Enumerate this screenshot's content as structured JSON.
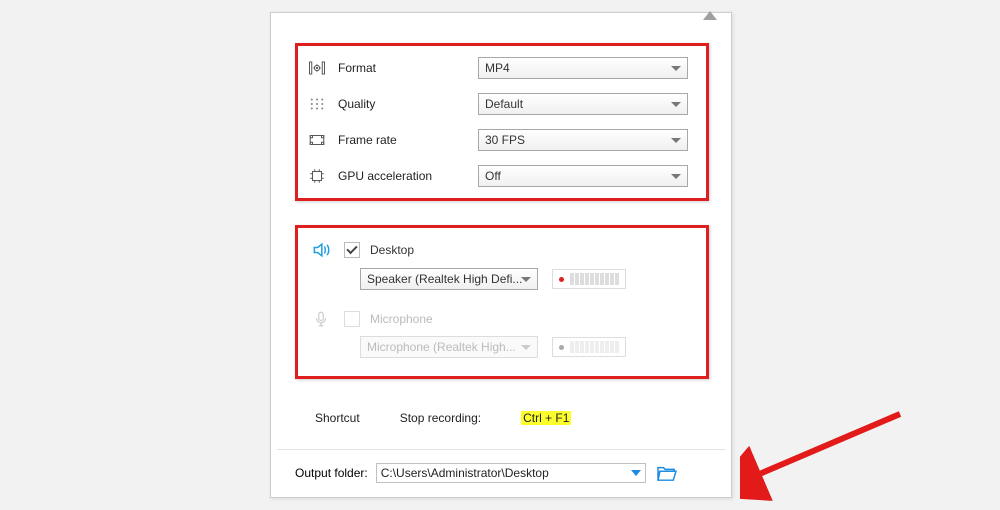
{
  "video": {
    "format_label": "Format",
    "format_value": "MP4",
    "quality_label": "Quality",
    "quality_value": "Default",
    "framerate_label": "Frame rate",
    "framerate_value": "30 FPS",
    "gpu_label": "GPU acceleration",
    "gpu_value": "Off"
  },
  "audio": {
    "desktop_label": "Desktop",
    "desktop_device": "Speaker (Realtek High Defi...",
    "microphone_label": "Microphone",
    "microphone_device": "Microphone (Realtek High..."
  },
  "shortcut": {
    "label": "Shortcut",
    "stop_label": "Stop recording:",
    "stop_key": "Ctrl + F1"
  },
  "output": {
    "label": "Output folder:",
    "path": "C:\\Users\\Administrator\\Desktop"
  }
}
